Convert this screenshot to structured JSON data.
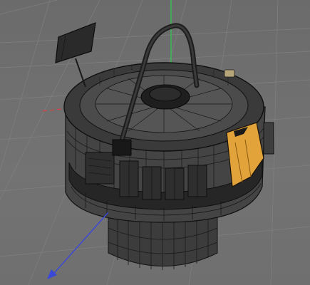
{
  "viewport": {
    "background": "#6f6f6f",
    "grid_color": "#7f7f7f",
    "wire_color": "#151515",
    "accent_orange": "#e2a33a",
    "axis_colors": {
      "x": "#d94040",
      "y": "#2ecc4a",
      "z": "#3a48d8"
    }
  },
  "model": {
    "description_icon": "space-station-pod-model",
    "highlighted_panel": "orange-hatch-panel"
  },
  "icons": {
    "gizmo": "axis-gizmo-icon",
    "antenna": "solar-panel-icon"
  }
}
